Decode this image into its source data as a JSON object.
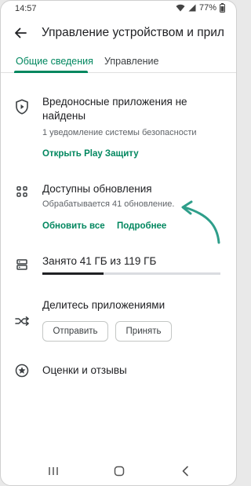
{
  "status_bar": {
    "time": "14:57",
    "battery": "77%",
    "icons": [
      "wifi-icon",
      "signal-icon",
      "battery-icon"
    ]
  },
  "app_bar": {
    "title": "Управление устройством и прил",
    "back_icon": "arrow-left-icon"
  },
  "tabs": [
    {
      "label": "Общие сведения",
      "active": true
    },
    {
      "label": "Управление",
      "active": false
    }
  ],
  "sections": {
    "protect": {
      "icon": "shield-icon",
      "title_line1": "Вредоносные приложения не",
      "title_line2": "найдены",
      "subtitle": "1 уведомление системы безопасности",
      "action": "Открыть Play Защиту"
    },
    "updates": {
      "icon": "apps-grid-icon",
      "title": "Доступны обновления",
      "subtitle": "Обрабатывается 41 обновление.",
      "action_update_all": "Обновить все",
      "action_details": "Подробнее"
    },
    "storage": {
      "icon": "storage-icon",
      "title": "Занято 41 ГБ из 119 ГБ",
      "used_fraction": 0.345
    },
    "share": {
      "icon": "share-apps-icon",
      "title": "Делитесь приложениями",
      "send_label": "Отправить",
      "accept_label": "Принять"
    },
    "ratings": {
      "icon": "star-circle-icon",
      "title": "Оценки и отзывы"
    }
  },
  "colors": {
    "accent": "#01875f",
    "text_primary": "#202124",
    "text_secondary": "#5f6368",
    "annotation_arrow": "#2e9e8a"
  },
  "nav_bar": {
    "icons": [
      "recent-apps-icon",
      "home-icon",
      "back-nav-icon"
    ]
  }
}
